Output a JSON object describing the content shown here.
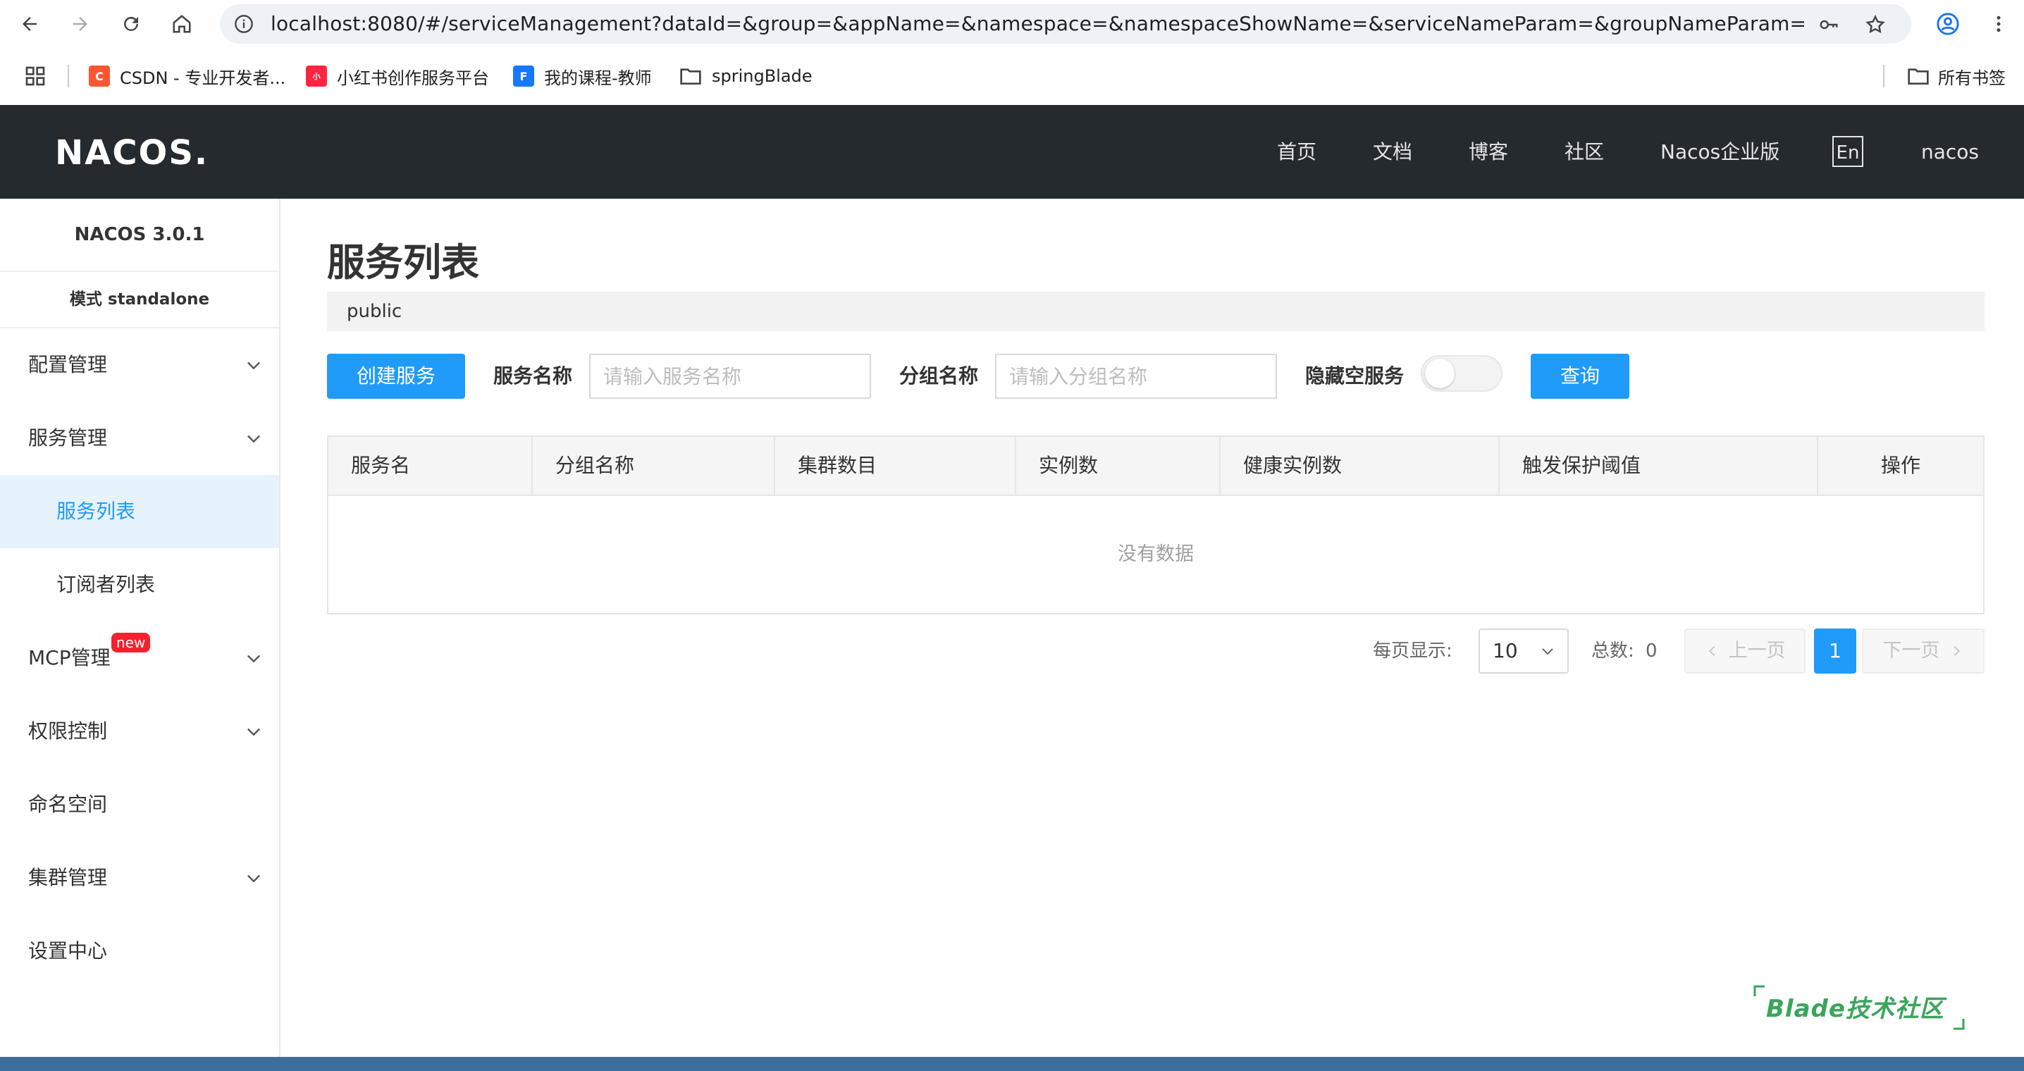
{
  "browser": {
    "url": "localhost:8080/#/serviceManagement?dataId=&group=&appName=&namespace=&namespaceShowName=&serviceNameParam=&groupNameParam=",
    "bookmarks": [
      {
        "label": "CSDN - 专业开发者...",
        "icon": "csdn-icon",
        "color": "#fc5531"
      },
      {
        "label": "小红书创作服务平台",
        "icon": "xiaohongshu-icon",
        "color": "#ff2442"
      },
      {
        "label": "我的课程-教师",
        "icon": "fb-course-icon",
        "color": "#1677ff"
      },
      {
        "label": "springBlade",
        "icon": "folder-icon"
      }
    ],
    "all_bookmarks": "所有书签"
  },
  "header": {
    "logo": "NACOS.",
    "nav": [
      "首页",
      "文档",
      "博客",
      "社区",
      "Nacos企业版"
    ],
    "lang": "En",
    "user": "nacos"
  },
  "sidebar": {
    "version": "NACOS 3.0.1",
    "mode": "模式 standalone",
    "items": [
      {
        "label": "配置管理",
        "expandable": true
      },
      {
        "label": "服务管理",
        "expandable": true
      },
      {
        "label": "服务列表",
        "sub": true,
        "active": true
      },
      {
        "label": "订阅者列表",
        "sub": true
      },
      {
        "label": "MCP管理",
        "expandable": true,
        "badge": "new"
      },
      {
        "label": "权限控制",
        "expandable": true
      },
      {
        "label": "命名空间"
      },
      {
        "label": "集群管理",
        "expandable": true
      },
      {
        "label": "设置中心"
      }
    ]
  },
  "main": {
    "title": "服务列表",
    "namespace": "public",
    "create_button": "创建服务",
    "service_name_label": "服务名称",
    "service_name_placeholder": "请输入服务名称",
    "group_name_label": "分组名称",
    "group_name_placeholder": "请输入分组名称",
    "hide_empty_label": "隐藏空服务",
    "query_button": "查询",
    "table": {
      "columns": [
        "服务名",
        "分组名称",
        "集群数目",
        "实例数",
        "健康实例数",
        "触发保护阈值",
        "操作"
      ],
      "empty_text": "没有数据"
    },
    "pager": {
      "per_page_label": "每页显示:",
      "per_page_value": "10",
      "total_label": "总数:",
      "total_value": "0",
      "prev": "上一页",
      "current": "1",
      "next": "下一页"
    },
    "watermark": "Blade技术社区"
  },
  "colors": {
    "accent": "#209bfa",
    "header_bg": "#252a2f",
    "active_bg": "#e6f3fd"
  }
}
